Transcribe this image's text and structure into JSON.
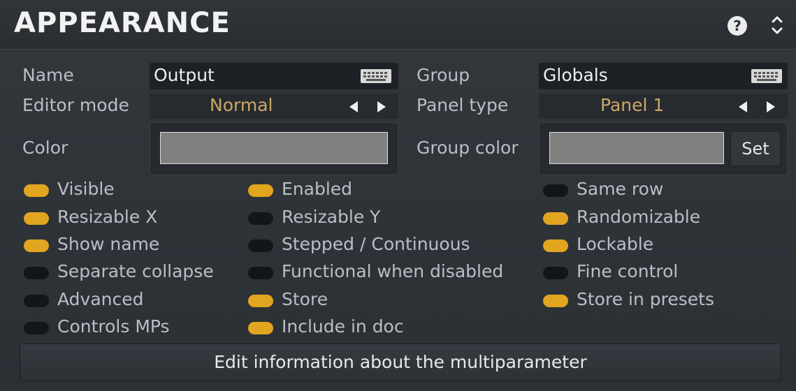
{
  "header": {
    "title": "APPEARANCE",
    "help_glyph": "?",
    "icons": [
      "help-icon",
      "collapse-expand-icon"
    ]
  },
  "fields": {
    "name_label": "Name",
    "name_value": "Output",
    "group_label": "Group",
    "group_value": "Globals",
    "editor_mode_label": "Editor mode",
    "editor_mode_value": "Normal",
    "panel_type_label": "Panel type",
    "panel_type_value": "Panel 1",
    "color_label": "Color",
    "group_color_label": "Group color",
    "set_label": "Set",
    "keyboard_icon": "keyboard-icon"
  },
  "colors": {
    "toggle_on": "#e2a51f",
    "toggle_off": "#131618",
    "selector_text": "#c9a865",
    "color_swatch": "#808080",
    "group_color_swatch": "#808080"
  },
  "options": [
    {
      "label": "Visible",
      "on": true
    },
    {
      "label": "Enabled",
      "on": true
    },
    {
      "label": "Same row",
      "on": false
    },
    {
      "label": "Resizable X",
      "on": true
    },
    {
      "label": "Resizable Y",
      "on": false
    },
    {
      "label": "Randomizable",
      "on": true
    },
    {
      "label": "Show name",
      "on": true
    },
    {
      "label": "Stepped / Continuous",
      "on": false
    },
    {
      "label": "Lockable",
      "on": true
    },
    {
      "label": "Separate collapse",
      "on": false
    },
    {
      "label": "Functional when disabled",
      "on": false
    },
    {
      "label": "Fine control",
      "on": false
    },
    {
      "label": "Advanced",
      "on": false
    },
    {
      "label": "Store",
      "on": true
    },
    {
      "label": "Store in presets",
      "on": true
    },
    {
      "label": "Controls MPs",
      "on": false
    },
    {
      "label": "Include in doc",
      "on": true
    }
  ],
  "footer": {
    "edit_button": "Edit information about the multiparameter"
  }
}
